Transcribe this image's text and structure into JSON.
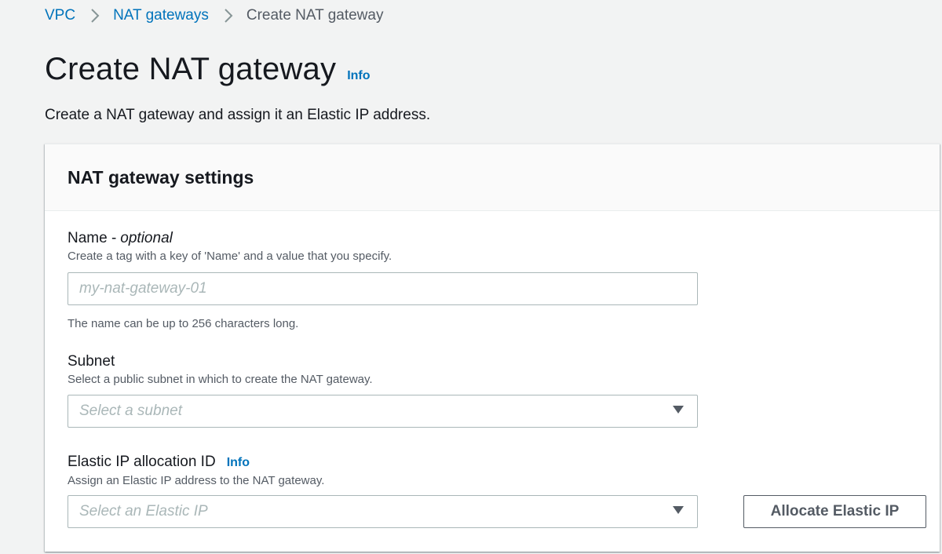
{
  "breadcrumb": {
    "items": [
      {
        "label": "VPC",
        "link": true
      },
      {
        "label": "NAT gateways",
        "link": true
      },
      {
        "label": "Create NAT gateway",
        "link": false
      }
    ]
  },
  "header": {
    "title": "Create NAT gateway",
    "info_label": "Info",
    "description": "Create a NAT gateway and assign it an Elastic IP address."
  },
  "panel": {
    "title": "NAT gateway settings",
    "name_field": {
      "label": "Name -",
      "optional": "optional",
      "description": "Create a tag with a key of 'Name' and a value that you specify.",
      "placeholder": "my-nat-gateway-01",
      "value": "",
      "constraint": "The name can be up to 256 characters long."
    },
    "subnet_field": {
      "label": "Subnet",
      "description": "Select a public subnet in which to create the NAT gateway.",
      "placeholder": "Select a subnet"
    },
    "eip_field": {
      "label": "Elastic IP allocation ID",
      "info_label": "Info",
      "description": "Assign an Elastic IP address to the NAT gateway.",
      "placeholder": "Select an Elastic IP",
      "allocate_button": "Allocate Elastic IP"
    }
  },
  "icons": {
    "breadcrumb_separator": "chevron-right-icon",
    "select_caret": "caret-down-icon"
  },
  "colors": {
    "link": "#0073bb",
    "page_background": "#f2f3f3",
    "input_border": "#aab7b8",
    "secondary_text": "#545b64"
  }
}
